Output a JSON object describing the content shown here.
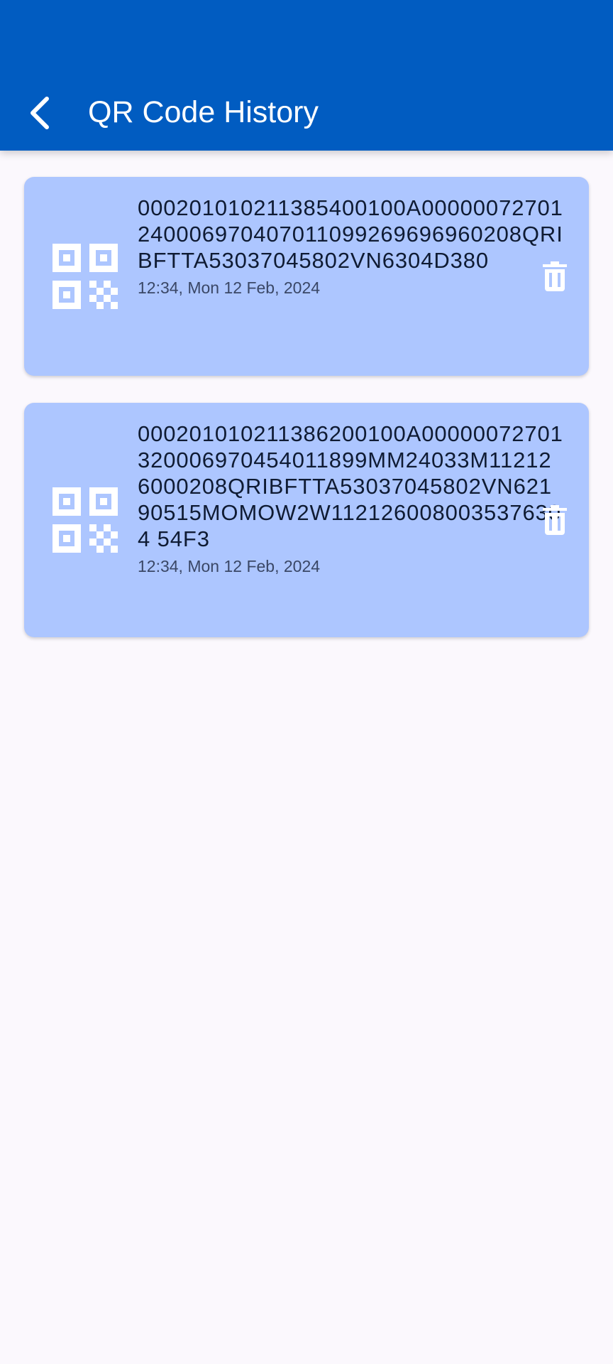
{
  "app_bar": {
    "title": "QR Code History",
    "back_icon": "arrow-back-icon",
    "background_color": "#015cc1"
  },
  "history": {
    "items": [
      {
        "code": "000201010211385400100A00000072701240006970407011099269696960208QRIBFTTA53037045802VN6304D380",
        "timestamp": "12:34, Mon 12 Feb, 2024",
        "icon": "qr-code-icon",
        "delete_icon": "trash-icon"
      },
      {
        "code": "000201010211386200100A00000072701320006970454011899MM24033M112126000208QRIBFTTA53037045802VN62190515MOMOW2W1121260080035376304 54F3",
        "timestamp": "12:34, Mon 12 Feb, 2024",
        "icon": "qr-code-icon",
        "delete_icon": "trash-icon"
      }
    ],
    "card_color": "#adc6ff"
  }
}
